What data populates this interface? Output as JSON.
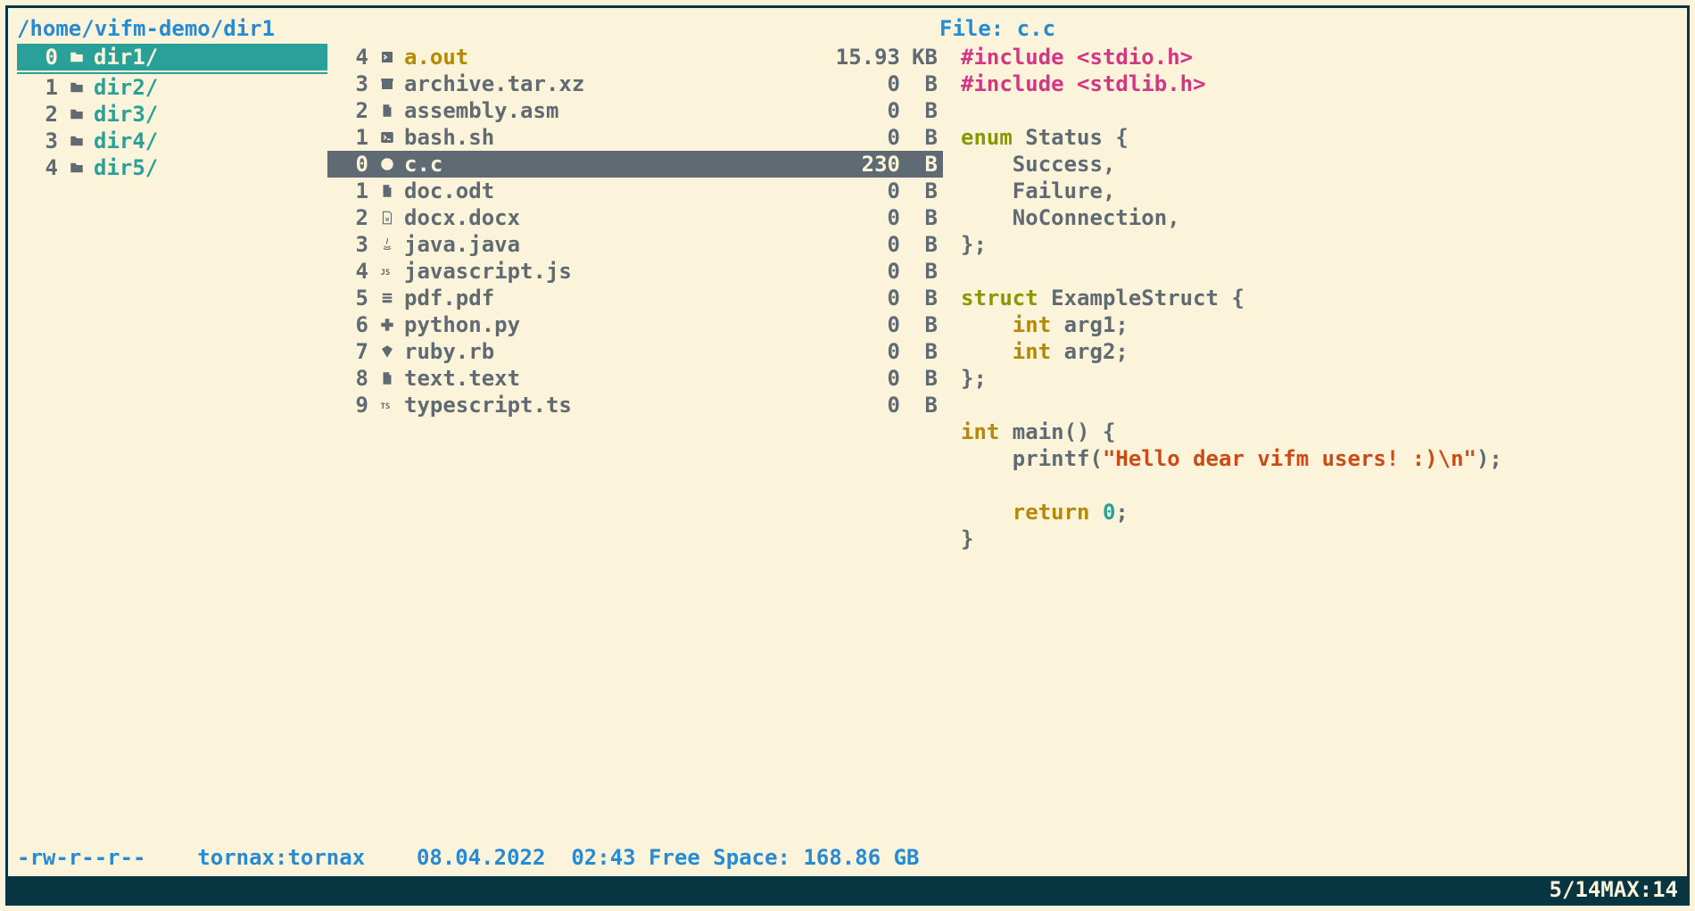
{
  "header": {
    "path": "/home/vifm-demo/dir1",
    "preview_label": "File: c.c"
  },
  "dirs": {
    "selected_index": 0,
    "items": [
      {
        "num": "0",
        "name": "dir1/"
      },
      {
        "num": "1",
        "name": "dir2/"
      },
      {
        "num": "2",
        "name": "dir3/"
      },
      {
        "num": "3",
        "name": "dir4/"
      },
      {
        "num": "4",
        "name": "dir5/"
      }
    ]
  },
  "files": {
    "selected_index": 4,
    "items": [
      {
        "num": "4",
        "name": "a.out",
        "size": "15.93",
        "unit": "KB",
        "icon": "exec",
        "cls": "exec-name"
      },
      {
        "num": "3",
        "name": "archive.tar.xz",
        "size": "0",
        "unit": "B",
        "icon": "archive",
        "cls": "file-name"
      },
      {
        "num": "2",
        "name": "assembly.asm",
        "size": "0",
        "unit": "B",
        "icon": "file",
        "cls": "file-name"
      },
      {
        "num": "1",
        "name": "bash.sh",
        "size": "0",
        "unit": "B",
        "icon": "term",
        "cls": "file-name"
      },
      {
        "num": "0",
        "name": "c.c",
        "size": "230",
        "unit": "B",
        "icon": "csrc",
        "cls": "file-name"
      },
      {
        "num": "1",
        "name": "doc.odt",
        "size": "0",
        "unit": "B",
        "icon": "file",
        "cls": "file-name"
      },
      {
        "num": "2",
        "name": "docx.docx",
        "size": "0",
        "unit": "B",
        "icon": "docx",
        "cls": "file-name"
      },
      {
        "num": "3",
        "name": "java.java",
        "size": "0",
        "unit": "B",
        "icon": "java",
        "cls": "file-name"
      },
      {
        "num": "4",
        "name": "javascript.js",
        "size": "0",
        "unit": "B",
        "icon": "js",
        "cls": "file-name"
      },
      {
        "num": "5",
        "name": "pdf.pdf",
        "size": "0",
        "unit": "B",
        "icon": "pdf",
        "cls": "file-name"
      },
      {
        "num": "6",
        "name": "python.py",
        "size": "0",
        "unit": "B",
        "icon": "py",
        "cls": "file-name"
      },
      {
        "num": "7",
        "name": "ruby.rb",
        "size": "0",
        "unit": "B",
        "icon": "ruby",
        "cls": "file-name"
      },
      {
        "num": "8",
        "name": "text.text",
        "size": "0",
        "unit": "B",
        "icon": "file",
        "cls": "file-name"
      },
      {
        "num": "9",
        "name": "typescript.ts",
        "size": "0",
        "unit": "B",
        "icon": "ts",
        "cls": "file-name"
      }
    ]
  },
  "preview": {
    "lines": [
      [
        {
          "t": "#include ",
          "c": "tok-pp"
        },
        {
          "t": "<stdio.h>",
          "c": "tok-pp"
        }
      ],
      [
        {
          "t": "#include ",
          "c": "tok-pp"
        },
        {
          "t": "<stdlib.h>",
          "c": "tok-pp"
        }
      ],
      [
        {
          "t": "",
          "c": ""
        }
      ],
      [
        {
          "t": "enum ",
          "c": "tok-kw"
        },
        {
          "t": "Status {",
          "c": ""
        }
      ],
      [
        {
          "t": "    Success,",
          "c": ""
        }
      ],
      [
        {
          "t": "    Failure,",
          "c": ""
        }
      ],
      [
        {
          "t": "    NoConnection,",
          "c": ""
        }
      ],
      [
        {
          "t": "};",
          "c": ""
        }
      ],
      [
        {
          "t": "",
          "c": ""
        }
      ],
      [
        {
          "t": "struct ",
          "c": "tok-kw"
        },
        {
          "t": "ExampleStruct {",
          "c": ""
        }
      ],
      [
        {
          "t": "    ",
          "c": ""
        },
        {
          "t": "int ",
          "c": "tok-type"
        },
        {
          "t": "arg1;",
          "c": ""
        }
      ],
      [
        {
          "t": "    ",
          "c": ""
        },
        {
          "t": "int ",
          "c": "tok-type"
        },
        {
          "t": "arg2;",
          "c": ""
        }
      ],
      [
        {
          "t": "};",
          "c": ""
        }
      ],
      [
        {
          "t": "",
          "c": ""
        }
      ],
      [
        {
          "t": "int ",
          "c": "tok-type"
        },
        {
          "t": "main() {",
          "c": ""
        }
      ],
      [
        {
          "t": "    printf(",
          "c": ""
        },
        {
          "t": "\"Hello dear vifm users! :)\\n\"",
          "c": "tok-str"
        },
        {
          "t": ");",
          "c": ""
        }
      ],
      [
        {
          "t": "",
          "c": ""
        }
      ],
      [
        {
          "t": "    ",
          "c": ""
        },
        {
          "t": "return ",
          "c": "tok-type"
        },
        {
          "t": "0",
          "c": "tok-num"
        },
        {
          "t": ";",
          "c": ""
        }
      ],
      [
        {
          "t": "}",
          "c": ""
        }
      ]
    ]
  },
  "status": {
    "perms": "-rw-r--r--",
    "owner": "tornax:tornax",
    "date": "08.04.2022",
    "time": "02:43",
    "free_label": "Free Space:",
    "free_value": "168.86 GB"
  },
  "footer": {
    "position": "5/14",
    "max_label": "MAX:",
    "max_value": "14"
  },
  "icons": {
    "folder": "<svg viewBox='0 0 24 24' fill='currentColor'><path d='M3 5h7l2 3h9v11H3z'/></svg>",
    "exec": "<svg viewBox='0 0 24 24' fill='currentColor'><path d='M4 4h16v16H4z'/><path d='M7 9l4 3-4 3' fill='none' stroke='#fcf4da' stroke-width='2'/></svg>",
    "archive": "<svg viewBox='0 0 24 24' fill='currentColor'><rect x='4' y='6' width='16' height='14'/><rect x='3' y='4' width='18' height='4'/></svg>",
    "file": "<svg viewBox='0 0 24 24' fill='currentColor'><path d='M6 3h9l3 3v15H6z'/><path d='M15 3v4h4' fill='#fcf4da'/></svg>",
    "term": "<svg viewBox='0 0 24 24' fill='currentColor'><rect x='3' y='4' width='18' height='16' rx='2'/><path d='M7 9l3 3-3 3M12 15h5' stroke='#fcf4da' stroke-width='2' fill='none'/></svg>",
    "csrc": "<svg viewBox='0 0 24 24' fill='currentColor'><circle cx='12' cy='12' r='9'/><text x='12' y='16' font-size='11' text-anchor='middle' fill='#fcf4da' font-family='monospace'>C</text></svg>",
    "docx": "<svg viewBox='0 0 24 24' fill='none' stroke='currentColor' stroke-width='1.5'><path d='M6 3h9l3 3v15H6z'/><text x='12' y='17' font-size='8' text-anchor='middle' fill='currentColor' stroke='none' font-family='monospace'>W</text></svg>",
    "java": "<svg viewBox='0 0 24 24' fill='currentColor'><path d='M8 14c0 3 8 3 8 0M7 17c0 3 10 3 10 0M12 3c3 3-3 5 0 8' fill='none' stroke='currentColor' stroke-width='1.5'/></svg>",
    "js": "<svg viewBox='0 0 24 24'><text x='2' y='17' font-size='12' font-weight='bold' fill='currentColor' font-family='monospace'>JS</text></svg>",
    "pdf": "<svg viewBox='0 0 24 24' fill='currentColor'><path d='M5 5h14v3H5zM5 10h14v3H5zM5 15h14v4H5z'/></svg>",
    "py": "<svg viewBox='0 0 24 24' fill='currentColor'><path d='M9 3h6v6h6v6h-6v6H9v-6H3V9h6z'/></svg>",
    "ruby": "<svg viewBox='0 0 24 24' fill='currentColor'><path d='M4 8l8-5 8 5-8 13z'/></svg>",
    "ts": "<svg viewBox='0 0 24 24'><text x='2' y='17' font-size='12' font-weight='bold' fill='currentColor' font-family='monospace'>TS</text></svg>"
  }
}
